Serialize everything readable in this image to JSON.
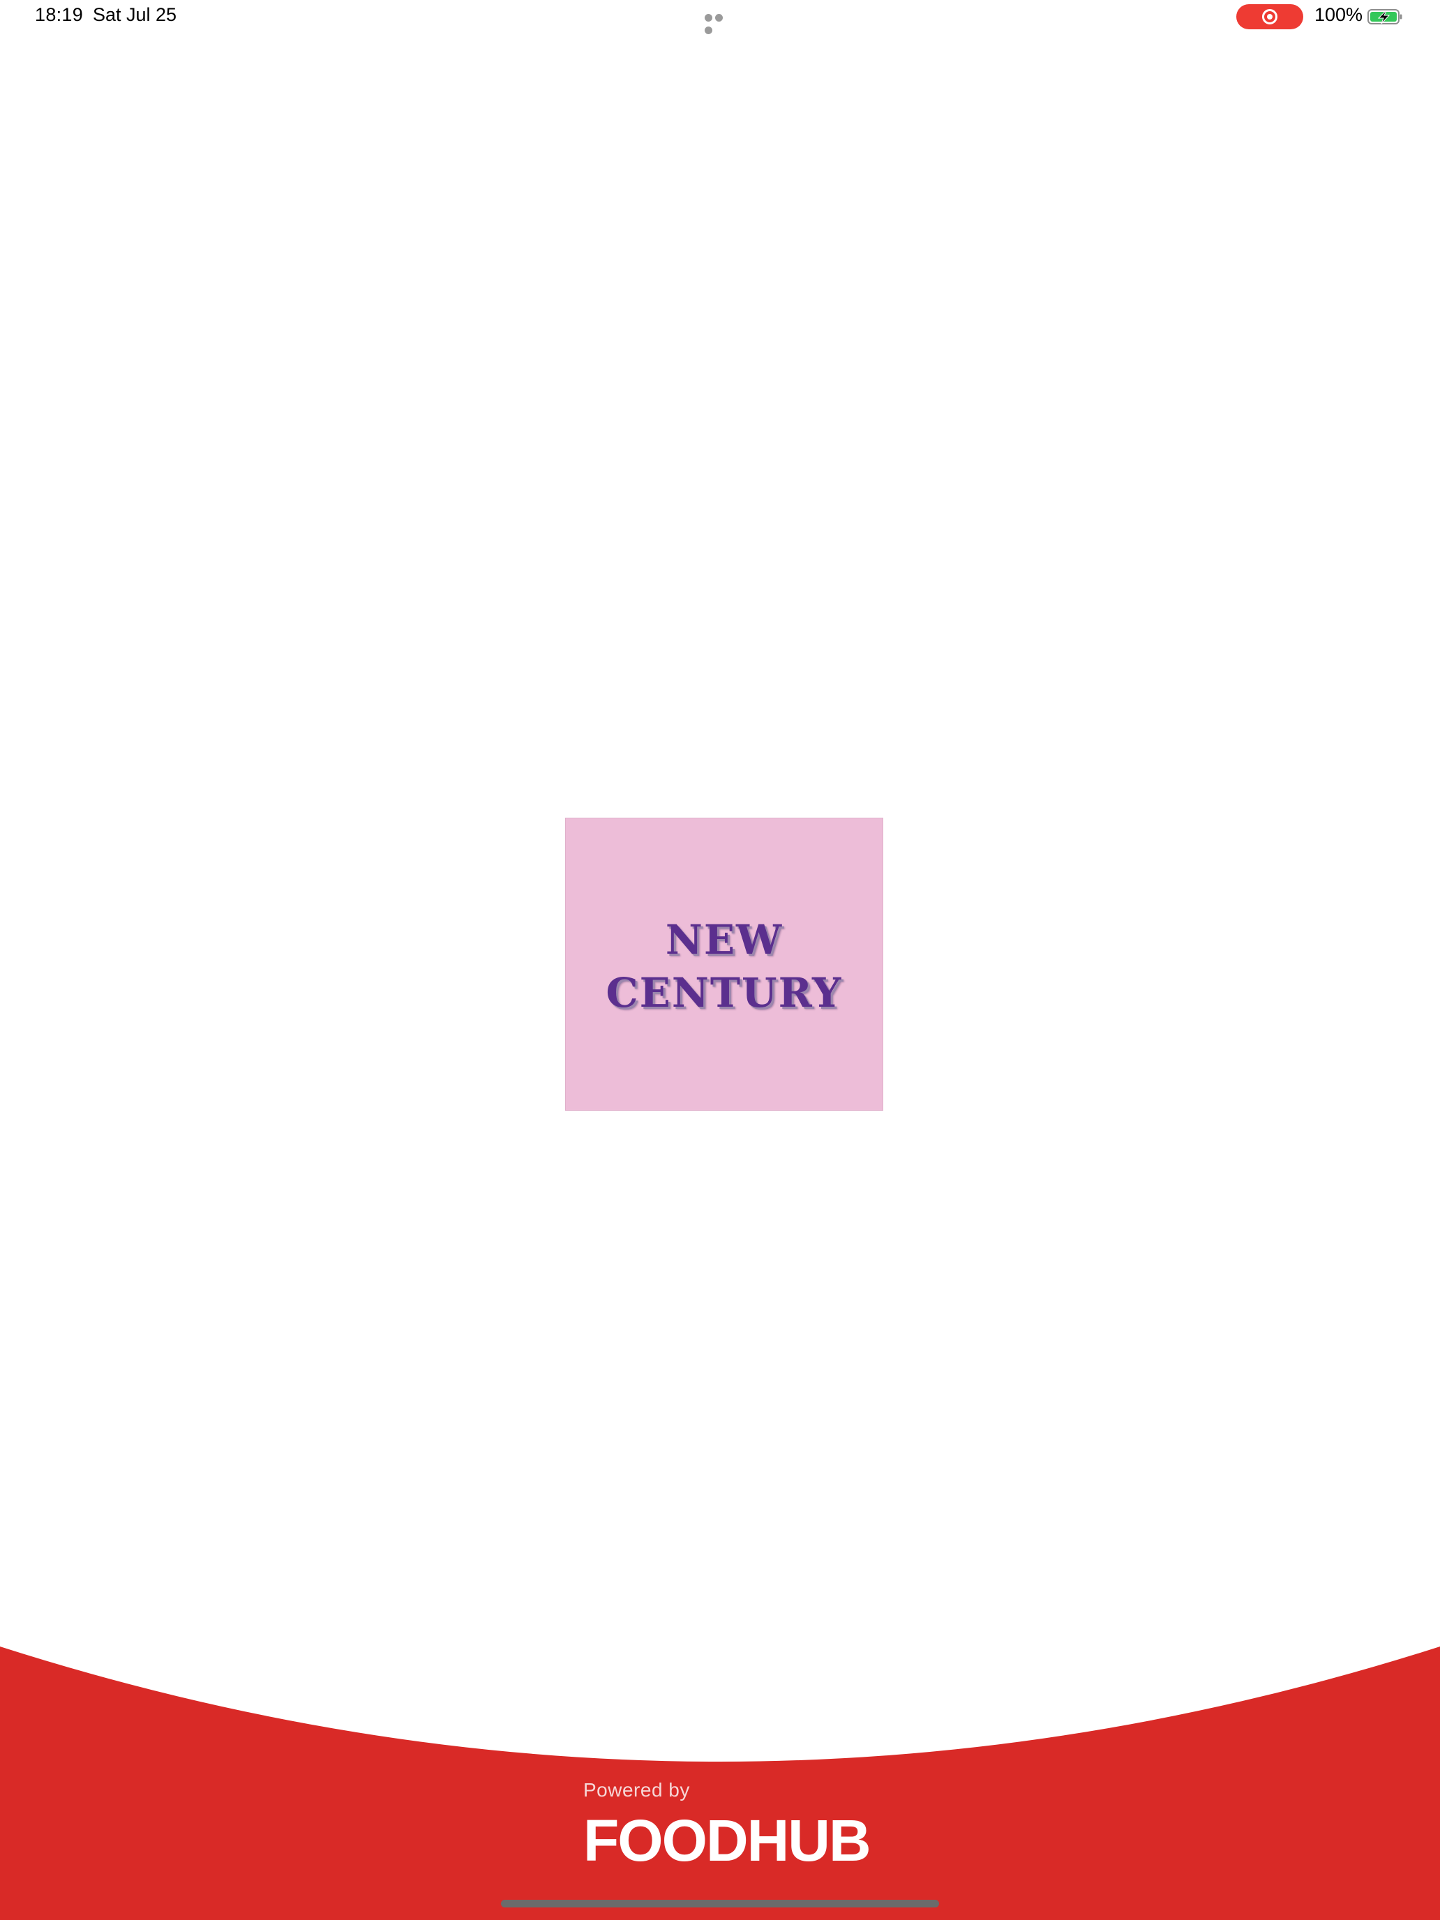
{
  "status_bar": {
    "time": "18:19",
    "date": "Sat Jul 25",
    "battery_percent": "100%",
    "battery_level": 1.0,
    "charging": true,
    "screen_recording": true
  },
  "splash": {
    "logo_line_1": "NEW",
    "logo_line_2": "CENTURY",
    "logo_background": "#edbdd8",
    "logo_text_color": "#5b2f8e"
  },
  "footer": {
    "powered_by": "Powered by",
    "brand": "FOODHUB",
    "trademark": "™",
    "brand_color": "#d92a27"
  }
}
